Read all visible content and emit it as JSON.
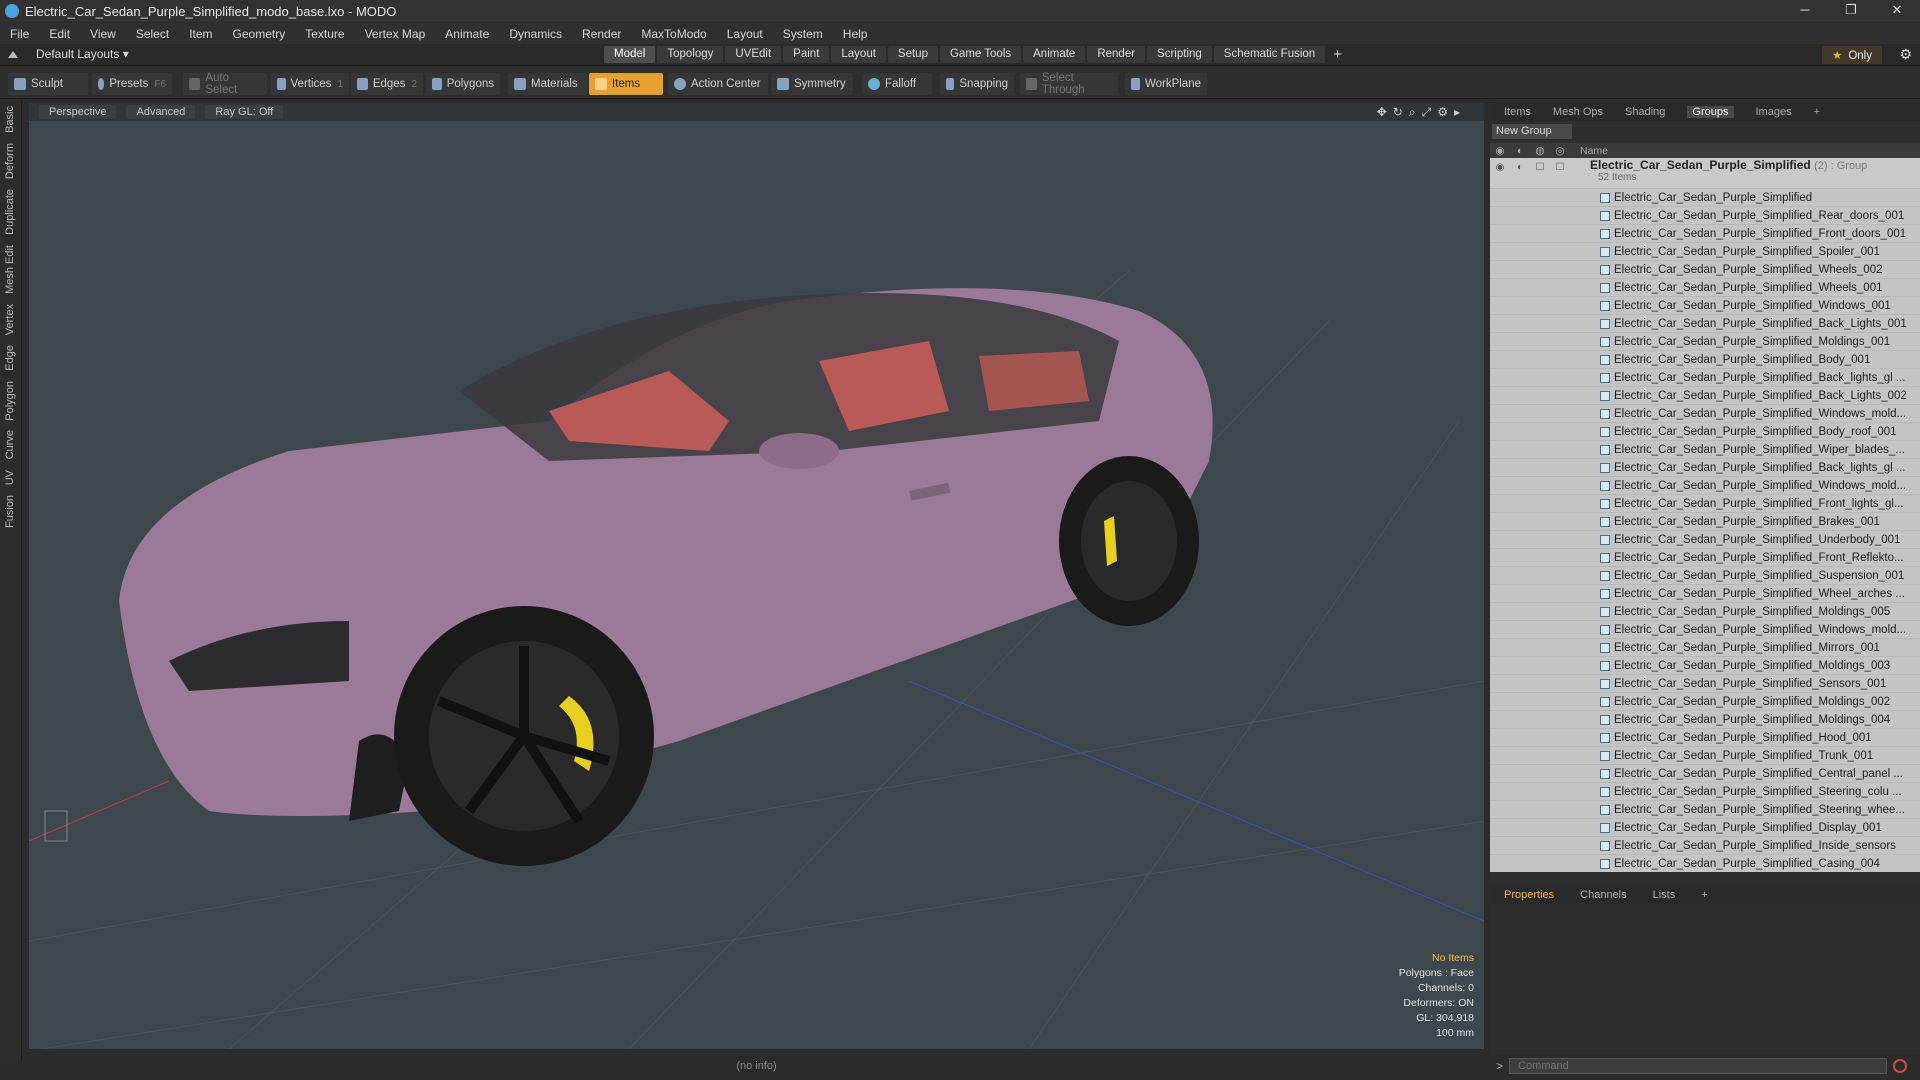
{
  "window": {
    "title": "Electric_Car_Sedan_Purple_Simplified_modo_base.lxo - MODO",
    "minimize": "─",
    "maximize": "❐",
    "close": "✕"
  },
  "menu": [
    "File",
    "Edit",
    "View",
    "Select",
    "Item",
    "Geometry",
    "Texture",
    "Vertex Map",
    "Animate",
    "Dynamics",
    "Render",
    "MaxToModo",
    "Layout",
    "System",
    "Help"
  ],
  "layout": {
    "preset": "Default Layouts ▾",
    "tabs": [
      "Model",
      "Topology",
      "UVEdit",
      "Paint",
      "Layout",
      "Setup",
      "Game Tools",
      "Animate",
      "Render",
      "Scripting",
      "Schematic Fusion"
    ],
    "active_tab": "Model",
    "only_label": "Only"
  },
  "toolbar": {
    "sculpt": "Sculpt",
    "presets": "Presets",
    "presets_key": "F6",
    "auto_select": "Auto Select",
    "vertices": "Vertices",
    "vertices_key": "1",
    "edges": "Edges",
    "edges_key": "2",
    "polygons": "Polygons",
    "materials": "Materials",
    "items": "Items",
    "action_center": "Action Center",
    "symmetry": "Symmetry",
    "falloff": "Falloff",
    "snapping": "Snapping",
    "select_through": "Select Through",
    "workplane": "WorkPlane"
  },
  "left_tabs": [
    "Basic",
    "Deform",
    "Duplicate",
    "Mesh Edit",
    "Vertex",
    "Edge",
    "Polygon",
    "Curve",
    "UV",
    "Fusion"
  ],
  "viewport": {
    "view": "Perspective",
    "shading": "Advanced",
    "raygl": "Ray GL: Off",
    "hud": {
      "selection": "No Items",
      "polygons": "Polygons : Face",
      "channels": "Channels: 0",
      "deformers": "Deformers: ON",
      "gl": "GL: 304,918",
      "scale": "100 mm"
    },
    "status": "(no info)"
  },
  "right_panel": {
    "tabs": [
      "Items",
      "Mesh Ops",
      "Shading",
      "Groups",
      "Images"
    ],
    "active_tab": "Groups",
    "new_group": "New Group",
    "column_name": "Name",
    "group": {
      "name": "Electric_Car_Sedan_Purple_Simplified",
      "type": "(2) : Group",
      "count": "52 Items"
    },
    "items": [
      "Electric_Car_Sedan_Purple_Simplified",
      "Electric_Car_Sedan_Purple_Simplified_Rear_doors_001",
      "Electric_Car_Sedan_Purple_Simplified_Front_doors_001",
      "Electric_Car_Sedan_Purple_Simplified_Spoiler_001",
      "Electric_Car_Sedan_Purple_Simplified_Wheels_002",
      "Electric_Car_Sedan_Purple_Simplified_Wheels_001",
      "Electric_Car_Sedan_Purple_Simplified_Windows_001",
      "Electric_Car_Sedan_Purple_Simplified_Back_Lights_001",
      "Electric_Car_Sedan_Purple_Simplified_Moldings_001",
      "Electric_Car_Sedan_Purple_Simplified_Body_001",
      "Electric_Car_Sedan_Purple_Simplified_Back_lights_gl ...",
      "Electric_Car_Sedan_Purple_Simplified_Back_Lights_002",
      "Electric_Car_Sedan_Purple_Simplified_Windows_mold...",
      "Electric_Car_Sedan_Purple_Simplified_Body_roof_001",
      "Electric_Car_Sedan_Purple_Simplified_Wiper_blades_...",
      "Electric_Car_Sedan_Purple_Simplified_Back_lights_gl ...",
      "Electric_Car_Sedan_Purple_Simplified_Windows_mold...",
      "Electric_Car_Sedan_Purple_Simplified_Front_lights_gl...",
      "Electric_Car_Sedan_Purple_Simplified_Brakes_001",
      "Electric_Car_Sedan_Purple_Simplified_Underbody_001",
      "Electric_Car_Sedan_Purple_Simplified_Front_Reflekto...",
      "Electric_Car_Sedan_Purple_Simplified_Suspension_001",
      "Electric_Car_Sedan_Purple_Simplified_Wheel_arches ...",
      "Electric_Car_Sedan_Purple_Simplified_Moldings_005",
      "Electric_Car_Sedan_Purple_Simplified_Windows_mold...",
      "Electric_Car_Sedan_Purple_Simplified_Mirrors_001",
      "Electric_Car_Sedan_Purple_Simplified_Moldings_003",
      "Electric_Car_Sedan_Purple_Simplified_Sensors_001",
      "Electric_Car_Sedan_Purple_Simplified_Moldings_002",
      "Electric_Car_Sedan_Purple_Simplified_Moldings_004",
      "Electric_Car_Sedan_Purple_Simplified_Hood_001",
      "Electric_Car_Sedan_Purple_Simplified_Trunk_001",
      "Electric_Car_Sedan_Purple_Simplified_Central_panel ...",
      "Electric_Car_Sedan_Purple_Simplified_Steering_colu ...",
      "Electric_Car_Sedan_Purple_Simplified_Steering_whee...",
      "Electric_Car_Sedan_Purple_Simplified_Display_001",
      "Electric_Car_Sedan_Purple_Simplified_Inside_sensors",
      "Electric_Car_Sedan_Purple_Simplified_Casing_004"
    ]
  },
  "bottom_panel": {
    "tabs": [
      "Properties",
      "Channels",
      "Lists"
    ],
    "active_tab": "Properties",
    "command_placeholder": "Command"
  },
  "colors": {
    "accent": "#e8a030",
    "car_body": "#9a7a96",
    "interior": "#b85a55",
    "brake": "#e8d020",
    "viewport_bg": "#3e474c"
  }
}
